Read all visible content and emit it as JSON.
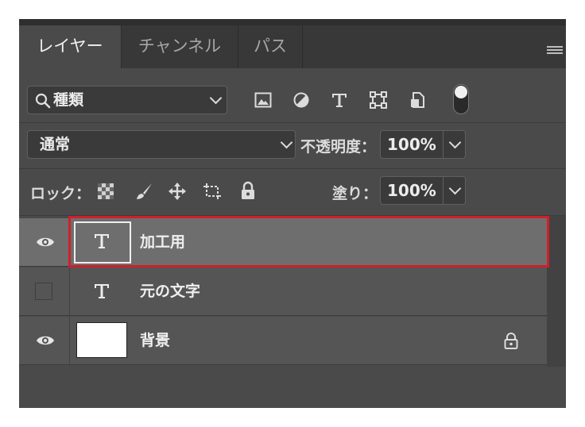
{
  "tabs": [
    {
      "label": "レイヤー",
      "active": true
    },
    {
      "label": "チャンネル",
      "active": false
    },
    {
      "label": "パス",
      "active": false
    }
  ],
  "filter": {
    "kind_label": "種類",
    "icons": [
      "image-filter-icon",
      "adjustment-filter-icon",
      "type-filter-icon",
      "shape-filter-icon",
      "smart-object-filter-icon",
      "filter-toggle-icon"
    ]
  },
  "blend": {
    "mode": "通常",
    "opacity_label": "不透明度：",
    "opacity_value": "100%"
  },
  "lock_row": {
    "lock_label": "ロック：",
    "fill_label": "塗り：",
    "fill_value": "100%",
    "icons": [
      "lock-transparent-icon",
      "lock-paint-icon",
      "lock-position-icon",
      "lock-artboard-icon",
      "lock-all-icon"
    ]
  },
  "layers": [
    {
      "name": "加工用",
      "type": "text",
      "visible": true,
      "selected": true,
      "locked": false
    },
    {
      "name": "元の文字",
      "type": "text",
      "visible": false,
      "selected": false,
      "locked": false
    },
    {
      "name": "背景",
      "type": "pixel",
      "visible": true,
      "selected": false,
      "locked": true
    }
  ],
  "colors": {
    "panel_bg": "#4a4a4a",
    "selected_row": "#6e6e6e",
    "highlight_box": "#d11f29"
  }
}
